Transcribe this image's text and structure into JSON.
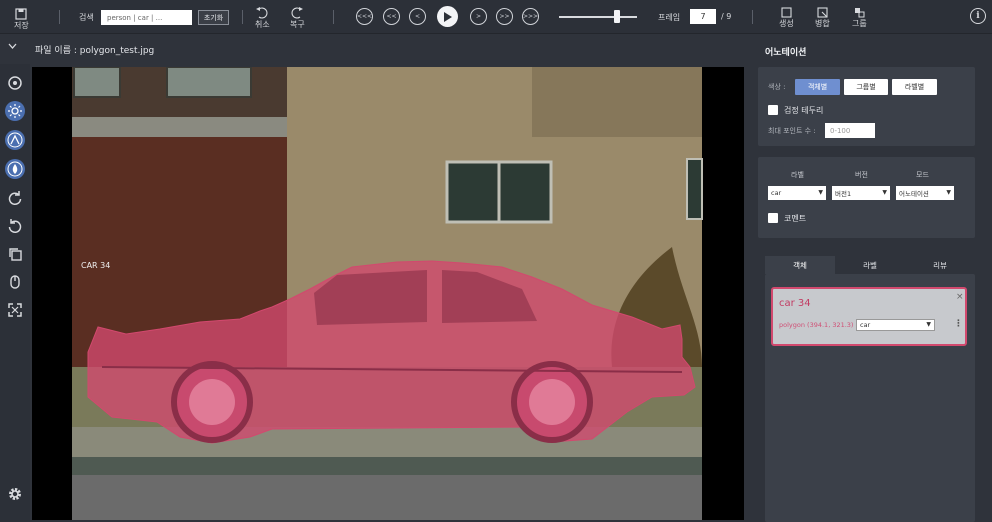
{
  "toolbar": {
    "save_label": "저장",
    "search_label": "검색",
    "search_value": "person | car | ...",
    "reset_label": "초기화",
    "undo_label": "취소",
    "redo_label": "복구",
    "nav": [
      "<<<",
      "<<",
      "<",
      ">",
      ">>",
      ">>>"
    ],
    "frame_label": "프레임",
    "frame_value": "7",
    "frame_total": "/ 9",
    "create_label": "생성",
    "merge_label": "병합",
    "group_label": "그룹",
    "info_label": "i"
  },
  "file": {
    "filename": "파일 이름 : polygon_test.jpg"
  },
  "canvas": {
    "object_label": "CAR 34",
    "mask_color": "#d2496e"
  },
  "annotation": {
    "title": "어노테이션",
    "color_label": "색상 :",
    "color_buttons": [
      "객체별",
      "그룹별",
      "라벨별"
    ],
    "border_label": "검정 테두리",
    "max_points_label": "최대 포인트 수 :",
    "max_points_placeholder": "0-100",
    "label_header": "라벨",
    "version_header": "버전",
    "mode_header": "모드",
    "label_value": "car",
    "version_value": "버전1",
    "mode_value": "어노테이션",
    "comment_label": "코멘트",
    "tabs": [
      "객체",
      "라벨",
      "리뷰"
    ],
    "card": {
      "title": "car 34",
      "close": "×",
      "polygon": "polygon (394.1, 321.3)",
      "label": "car"
    }
  }
}
